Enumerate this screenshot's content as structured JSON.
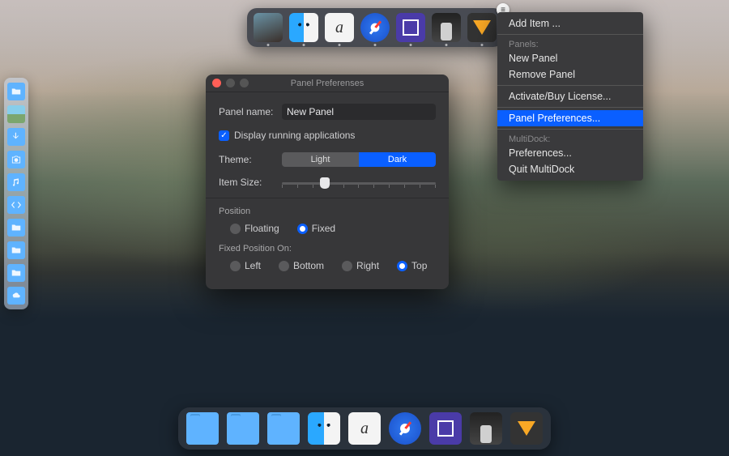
{
  "top_panel": {
    "items": [
      "wallpaper",
      "finder",
      "fontbook",
      "safari",
      "mission-control",
      "automator",
      "sketch"
    ]
  },
  "context_menu": {
    "add_item": "Add Item ...",
    "panels_header": "Panels:",
    "new_panel": "New Panel",
    "remove_panel": "Remove Panel",
    "activate": "Activate/Buy License...",
    "panel_prefs": "Panel Preferences...",
    "multidock_header": "MultiDock:",
    "preferences": "Preferences...",
    "quit": "Quit MultiDock"
  },
  "prefs_window": {
    "title": "Panel Preferenses",
    "panel_name_label": "Panel name:",
    "panel_name_value": "New Panel",
    "display_running_label": "Display running applications",
    "theme_label": "Theme:",
    "theme_light": "Light",
    "theme_dark": "Dark",
    "item_size_label": "Item Size:",
    "position_header": "Position",
    "floating": "Floating",
    "fixed": "Fixed",
    "fixed_pos_header": "Fixed Position On:",
    "left": "Left",
    "bottom": "Bottom",
    "right": "Right",
    "top": "Top"
  },
  "left_dock": {
    "count": 10
  },
  "bottom_dock": {
    "items": [
      "folder",
      "folder",
      "folder",
      "finder",
      "fontbook",
      "safari",
      "mission-control",
      "automator",
      "sketch"
    ]
  }
}
